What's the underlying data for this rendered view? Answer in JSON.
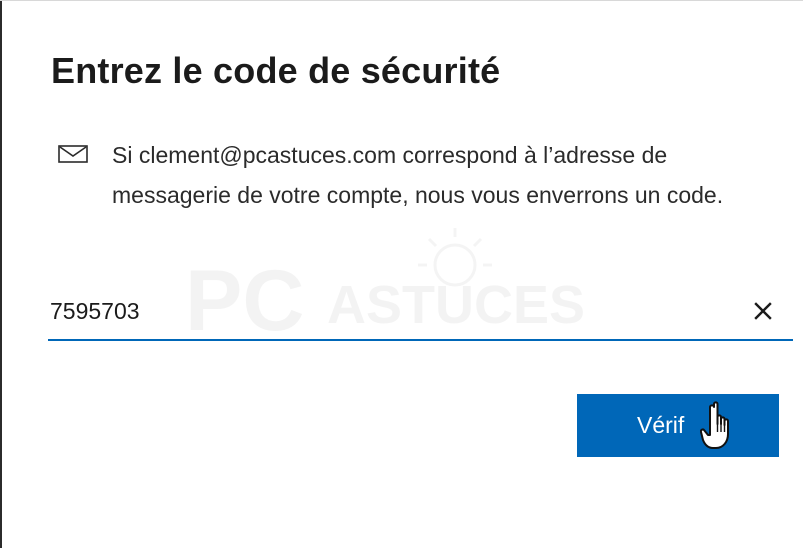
{
  "dialog": {
    "title": "Entrez le code de sécurité",
    "icon": "mail-icon",
    "description": "Si clement@pcastuces.com correspond à l’adresse de messagerie de votre compte, nous vous enverrons un code.",
    "watermark": {
      "brand_text": "PC",
      "brand_subtext": "ASTUCES"
    },
    "code_input": {
      "value": "7595703",
      "clear_icon": "close-icon"
    },
    "verify_button": {
      "label": "Vérif"
    },
    "cursor": "hand-pointer-cursor",
    "colors": {
      "accent": "#0067b8",
      "text": "#1b1b1b",
      "button_text": "#ffffff"
    }
  }
}
